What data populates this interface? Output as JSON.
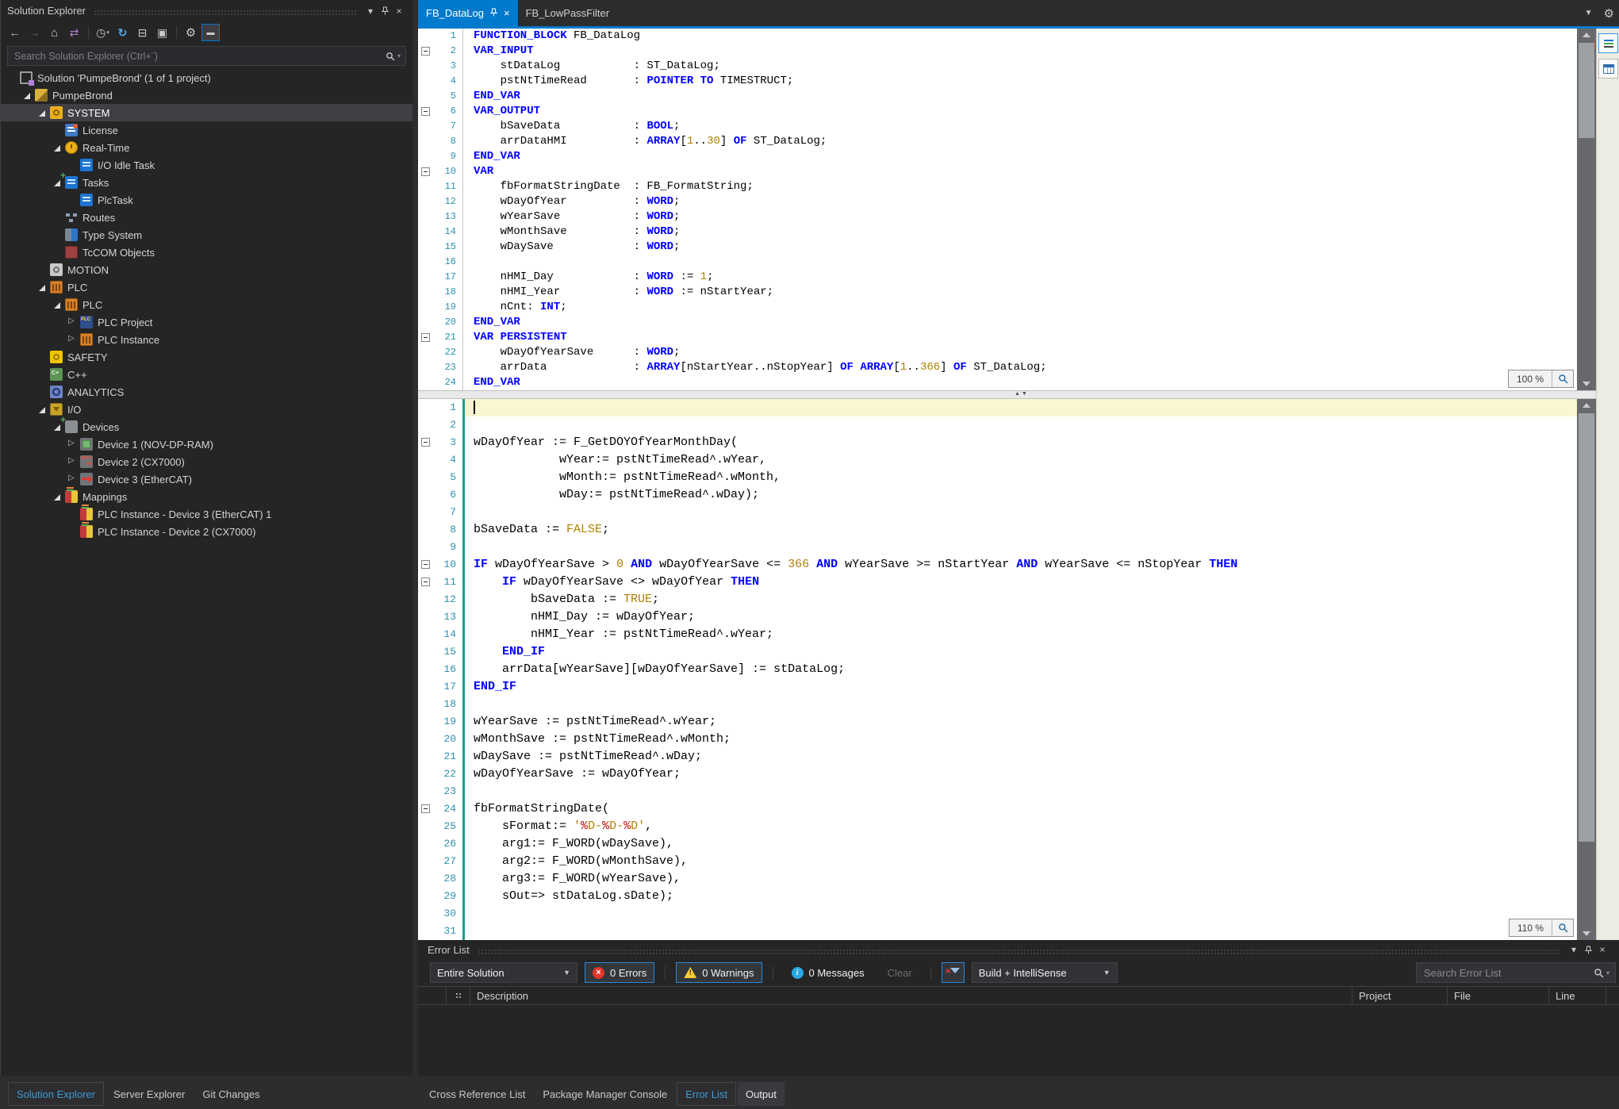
{
  "solution_explorer": {
    "title": "Solution Explorer",
    "search_placeholder": "Search Solution Explorer (Ctrl+¨)",
    "toolbar": [
      {
        "name": "back"
      },
      {
        "name": "forward",
        "dim": true
      },
      {
        "name": "home"
      },
      {
        "name": "sync-with-active-document"
      },
      {
        "sep": true
      },
      {
        "name": "pending-changes-filter"
      },
      {
        "name": "refresh"
      },
      {
        "name": "collapse-all"
      },
      {
        "name": "properties"
      },
      {
        "sep": true
      },
      {
        "name": "edit-project"
      },
      {
        "name": "preview-selected-items",
        "selected": true
      }
    ],
    "tree": [
      {
        "label": "Solution 'PumpeBrond' (1 of 1 project)",
        "level": 0,
        "expand": "none",
        "icon": "solution"
      },
      {
        "label": "PumpeBrond",
        "level": 1,
        "expand": "open",
        "icon": "project"
      },
      {
        "label": "SYSTEM",
        "level": 2,
        "expand": "open",
        "icon": "system",
        "selected": true
      },
      {
        "label": "License",
        "level": 3,
        "expand": "none",
        "icon": "license"
      },
      {
        "label": "Real-Time",
        "level": 3,
        "expand": "open",
        "icon": "realtime"
      },
      {
        "label": "I/O Idle Task",
        "level": 4,
        "expand": "none",
        "icon": "task"
      },
      {
        "label": "Tasks",
        "level": 3,
        "expand": "open",
        "icon": "tasks"
      },
      {
        "label": "PlcTask",
        "level": 4,
        "expand": "none",
        "icon": "task"
      },
      {
        "label": "Routes",
        "level": 3,
        "expand": "none",
        "icon": "routes"
      },
      {
        "label": "Type System",
        "level": 3,
        "expand": "none",
        "icon": "typesystem"
      },
      {
        "label": "TcCOM Objects",
        "level": 3,
        "expand": "none",
        "icon": "tccom"
      },
      {
        "label": "MOTION",
        "level": 2,
        "expand": "none",
        "icon": "motion"
      },
      {
        "label": "PLC",
        "level": 2,
        "expand": "open",
        "icon": "plc"
      },
      {
        "label": "PLC",
        "level": 3,
        "expand": "open",
        "icon": "plc"
      },
      {
        "label": "PLC Project",
        "level": 4,
        "expand": "closed",
        "icon": "plcproject"
      },
      {
        "label": "PLC Instance",
        "level": 4,
        "expand": "closed",
        "icon": "plcinstance"
      },
      {
        "label": "SAFETY",
        "level": 2,
        "expand": "none",
        "icon": "safety"
      },
      {
        "label": "C++",
        "level": 2,
        "expand": "none",
        "icon": "cpp"
      },
      {
        "label": "ANALYTICS",
        "level": 2,
        "expand": "none",
        "icon": "analytics"
      },
      {
        "label": "I/O",
        "level": 2,
        "expand": "open",
        "icon": "io"
      },
      {
        "label": "Devices",
        "level": 3,
        "expand": "open",
        "icon": "devices"
      },
      {
        "label": "Device 1 (NOV-DP-RAM)",
        "level": 4,
        "expand": "closed",
        "icon": "device-nv"
      },
      {
        "label": "Device 2 (CX7000)",
        "level": 4,
        "expand": "closed",
        "icon": "device-cx"
      },
      {
        "label": "Device 3 (EtherCAT)",
        "level": 4,
        "expand": "closed",
        "icon": "device-ecat"
      },
      {
        "label": "Mappings",
        "level": 3,
        "expand": "open",
        "icon": "mappings"
      },
      {
        "label": "PLC Instance - Device 3 (EtherCAT) 1",
        "level": 4,
        "expand": "none",
        "icon": "mapping"
      },
      {
        "label": "PLC Instance - Device 2 (CX7000)",
        "level": 4,
        "expand": "none",
        "icon": "mapping"
      }
    ]
  },
  "editor": {
    "tabs": [
      {
        "label": "FB_DataLog",
        "active": true
      },
      {
        "label": "FB_LowPassFilter",
        "active": false
      }
    ],
    "declaration": {
      "zoom_label": "100 %",
      "lines": [
        {
          "n": 1,
          "t": [
            [
              "k",
              "FUNCTION_BLOCK"
            ],
            [
              "i",
              " FB_DataLog"
            ]
          ]
        },
        {
          "n": 2,
          "f": 1,
          "t": [
            [
              "k",
              "VAR_INPUT"
            ]
          ]
        },
        {
          "n": 3,
          "t": [
            [
              "i",
              "    stDataLog           : ST_DataLog;"
            ]
          ]
        },
        {
          "n": 4,
          "t": [
            [
              "i",
              "    pstNtTimeRead       : "
            ],
            [
              "k",
              "POINTER TO"
            ],
            [
              "i",
              " TIMESTRUCT;"
            ]
          ]
        },
        {
          "n": 5,
          "t": [
            [
              "k",
              "END_VAR"
            ]
          ]
        },
        {
          "n": 6,
          "f": 1,
          "t": [
            [
              "k",
              "VAR_OUTPUT"
            ]
          ]
        },
        {
          "n": 7,
          "t": [
            [
              "i",
              "    bSaveData           : "
            ],
            [
              "k",
              "BOOL"
            ],
            [
              "i",
              ";"
            ]
          ]
        },
        {
          "n": 8,
          "t": [
            [
              "i",
              "    arrDataHMI          : "
            ],
            [
              "k",
              "ARRAY"
            ],
            [
              "i",
              "["
            ],
            [
              "n",
              "1"
            ],
            [
              "i",
              ".."
            ],
            [
              "n",
              "30"
            ],
            [
              "i",
              "] "
            ],
            [
              "k",
              "OF"
            ],
            [
              "i",
              " ST_DataLog;"
            ]
          ]
        },
        {
          "n": 9,
          "t": [
            [
              "k",
              "END_VAR"
            ]
          ]
        },
        {
          "n": 10,
          "f": 1,
          "t": [
            [
              "k",
              "VAR"
            ]
          ]
        },
        {
          "n": 11,
          "t": [
            [
              "i",
              "    fbFormatStringDate  : FB_FormatString;"
            ]
          ]
        },
        {
          "n": 12,
          "t": [
            [
              "i",
              "    wDayOfYear          : "
            ],
            [
              "k",
              "WORD"
            ],
            [
              "i",
              ";"
            ]
          ]
        },
        {
          "n": 13,
          "t": [
            [
              "i",
              "    wYearSave           : "
            ],
            [
              "k",
              "WORD"
            ],
            [
              "i",
              ";"
            ]
          ]
        },
        {
          "n": 14,
          "t": [
            [
              "i",
              "    wMonthSave          : "
            ],
            [
              "k",
              "WORD"
            ],
            [
              "i",
              ";"
            ]
          ]
        },
        {
          "n": 15,
          "t": [
            [
              "i",
              "    wDaySave            : "
            ],
            [
              "k",
              "WORD"
            ],
            [
              "i",
              ";"
            ]
          ]
        },
        {
          "n": 16,
          "t": []
        },
        {
          "n": 17,
          "t": [
            [
              "i",
              "    nHMI_Day            : "
            ],
            [
              "k",
              "WORD"
            ],
            [
              "i",
              " := "
            ],
            [
              "n",
              "1"
            ],
            [
              "i",
              ";"
            ]
          ]
        },
        {
          "n": 18,
          "t": [
            [
              "i",
              "    nHMI_Year           : "
            ],
            [
              "k",
              "WORD"
            ],
            [
              "i",
              " := nStartYear;"
            ]
          ]
        },
        {
          "n": 19,
          "t": [
            [
              "i",
              "    nCnt: "
            ],
            [
              "k",
              "INT"
            ],
            [
              "i",
              ";"
            ]
          ]
        },
        {
          "n": 20,
          "t": [
            [
              "k",
              "END_VAR"
            ]
          ]
        },
        {
          "n": 21,
          "f": 1,
          "t": [
            [
              "k",
              "VAR PERSISTENT"
            ]
          ]
        },
        {
          "n": 22,
          "t": [
            [
              "i",
              "    wDayOfYearSave      : "
            ],
            [
              "k",
              "WORD"
            ],
            [
              "i",
              ";"
            ]
          ]
        },
        {
          "n": 23,
          "t": [
            [
              "i",
              "    arrData             : "
            ],
            [
              "k",
              "ARRAY"
            ],
            [
              "i",
              "[nStartYear..nStopYear] "
            ],
            [
              "k",
              "OF"
            ],
            [
              "i",
              " "
            ],
            [
              "k",
              "ARRAY"
            ],
            [
              "i",
              "["
            ],
            [
              "n",
              "1"
            ],
            [
              "i",
              ".."
            ],
            [
              "n",
              "366"
            ],
            [
              "i",
              "] "
            ],
            [
              "k",
              "OF"
            ],
            [
              "i",
              " ST_DataLog;"
            ]
          ]
        },
        {
          "n": 24,
          "t": [
            [
              "k",
              "END_VAR"
            ]
          ]
        }
      ]
    },
    "implementation": {
      "zoom_label": "110 %",
      "lines": [
        {
          "n": 1,
          "hl": 1,
          "caret": 1,
          "t": []
        },
        {
          "n": 2,
          "t": []
        },
        {
          "n": 3,
          "f": 1,
          "t": [
            [
              "i",
              "wDayOfYear := F_GetDOYOfYearMonthDay("
            ]
          ]
        },
        {
          "n": 4,
          "t": [
            [
              "i",
              "            wYear:= pstNtTimeRead^.wYear,"
            ]
          ]
        },
        {
          "n": 5,
          "t": [
            [
              "i",
              "            wMonth:= pstNtTimeRead^.wMonth,"
            ]
          ]
        },
        {
          "n": 6,
          "t": [
            [
              "i",
              "            wDay:= pstNtTimeRead^.wDay);"
            ]
          ]
        },
        {
          "n": 7,
          "t": []
        },
        {
          "n": 8,
          "t": [
            [
              "i",
              "bSaveData := "
            ],
            [
              "n",
              "FALSE"
            ],
            [
              "i",
              ";"
            ]
          ]
        },
        {
          "n": 9,
          "t": []
        },
        {
          "n": 10,
          "f": 1,
          "t": [
            [
              "k",
              "IF"
            ],
            [
              "i",
              " wDayOfYearSave > "
            ],
            [
              "n",
              "0"
            ],
            [
              "i",
              " "
            ],
            [
              "k",
              "AND"
            ],
            [
              "i",
              " wDayOfYearSave <= "
            ],
            [
              "n",
              "366"
            ],
            [
              "i",
              " "
            ],
            [
              "k",
              "AND"
            ],
            [
              "i",
              " wYearSave >= nStartYear "
            ],
            [
              "k",
              "AND"
            ],
            [
              "i",
              " wYearSave <= nStopYear "
            ],
            [
              "k",
              "THEN"
            ]
          ]
        },
        {
          "n": 11,
          "f": 1,
          "t": [
            [
              "i",
              "    "
            ],
            [
              "k",
              "IF"
            ],
            [
              "i",
              " wDayOfYearSave <> wDayOfYear "
            ],
            [
              "k",
              "THEN"
            ]
          ]
        },
        {
          "n": 12,
          "t": [
            [
              "i",
              "        bSaveData := "
            ],
            [
              "n",
              "TRUE"
            ],
            [
              "i",
              ";"
            ]
          ]
        },
        {
          "n": 13,
          "t": [
            [
              "i",
              "        nHMI_Day := wDayOfYear;"
            ]
          ]
        },
        {
          "n": 14,
          "t": [
            [
              "i",
              "        nHMI_Year := pstNtTimeRead^.wYear;"
            ]
          ]
        },
        {
          "n": 15,
          "t": [
            [
              "i",
              "    "
            ],
            [
              "k",
              "END_IF"
            ]
          ]
        },
        {
          "n": 16,
          "t": [
            [
              "i",
              "    arrData[wYearSave][wDayOfYearSave] := stDataLog;"
            ]
          ]
        },
        {
          "n": 17,
          "t": [
            [
              "k",
              "END_IF"
            ]
          ]
        },
        {
          "n": 18,
          "t": []
        },
        {
          "n": 19,
          "t": [
            [
              "i",
              "wYearSave := pstNtTimeRead^.wYear;"
            ]
          ]
        },
        {
          "n": 20,
          "t": [
            [
              "i",
              "wMonthSave := pstNtTimeRead^.wMonth;"
            ]
          ]
        },
        {
          "n": 21,
          "t": [
            [
              "i",
              "wDaySave := pstNtTimeRead^.wDay;"
            ]
          ]
        },
        {
          "n": 22,
          "t": [
            [
              "i",
              "wDayOfYearSave := wDayOfYear;"
            ]
          ]
        },
        {
          "n": 23,
          "t": []
        },
        {
          "n": 24,
          "f": 1,
          "t": [
            [
              "i",
              "fbFormatStringDate("
            ]
          ]
        },
        {
          "n": 25,
          "t": [
            [
              "i",
              "    sFormat:= "
            ],
            [
              "s",
              "'"
            ],
            [
              "r",
              "%"
            ],
            [
              "s",
              "D-"
            ],
            [
              "r",
              "%"
            ],
            [
              "s",
              "D-"
            ],
            [
              "r",
              "%"
            ],
            [
              "s",
              "D'"
            ],
            [
              "i",
              ","
            ]
          ]
        },
        {
          "n": 26,
          "t": [
            [
              "i",
              "    arg1:= F_WORD(wDaySave),"
            ]
          ]
        },
        {
          "n": 27,
          "t": [
            [
              "i",
              "    arg2:= F_WORD(wMonthSave),"
            ]
          ]
        },
        {
          "n": 28,
          "t": [
            [
              "i",
              "    arg3:= F_WORD(wYearSave),"
            ]
          ]
        },
        {
          "n": 29,
          "t": [
            [
              "i",
              "    sOut=> stDataLog.sDate);"
            ]
          ]
        },
        {
          "n": 30,
          "t": []
        },
        {
          "n": 31,
          "t": []
        }
      ]
    }
  },
  "error_list": {
    "title": "Error List",
    "scope": "Entire Solution",
    "errors_label": "0 Errors",
    "warnings_label": "0 Warnings",
    "messages_label": "0 Messages",
    "clear_label": "Clear",
    "build_filter": "Build + IntelliSense",
    "search_placeholder": "Search Error List",
    "columns": [
      "Description",
      "Project",
      "File",
      "Line"
    ]
  },
  "bottom_bar": {
    "left": [
      {
        "label": "Solution Explorer",
        "style": "active-blue"
      },
      {
        "label": "Server Explorer",
        "style": "plain"
      },
      {
        "label": "Git Changes",
        "style": "plain"
      }
    ],
    "right": [
      {
        "label": "Cross Reference List",
        "style": "plain"
      },
      {
        "label": "Package Manager Console",
        "style": "plain"
      },
      {
        "label": "Error List",
        "style": "active-blue"
      },
      {
        "label": "Output",
        "style": "lighter"
      }
    ]
  },
  "colors": {
    "accent": "#007ACC",
    "keyword": "#0000FF",
    "literal": "#AF8000",
    "line_number": "#2B91AF",
    "editor_bg": "#FFFFFF",
    "panel_bg": "#252526"
  }
}
